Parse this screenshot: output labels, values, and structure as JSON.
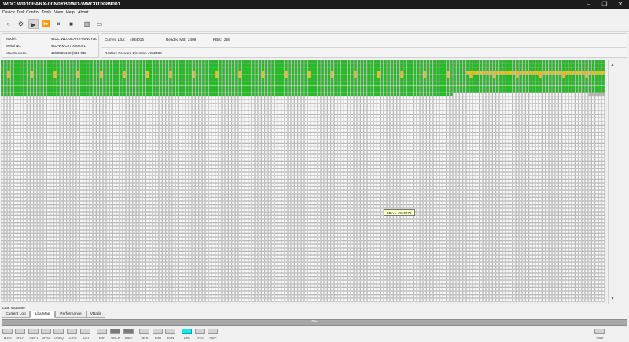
{
  "window": {
    "title": "WDC WD10EARX-00N0YB0WD-WMC0T0089001",
    "controls": [
      "minimize-icon",
      "maximize-icon",
      "close-icon"
    ]
  },
  "menu": [
    "Device",
    "Task Control",
    "Tools",
    "View",
    "Help",
    "About"
  ],
  "toolbar": {
    "buttons": [
      {
        "name": "refresh-icon",
        "glyph": "○"
      },
      {
        "name": "settings-icon",
        "glyph": "⚙"
      },
      {
        "name": "play-icon",
        "glyph": "▶"
      },
      {
        "name": "fast-forward-icon",
        "glyph": "⏩"
      },
      {
        "name": "pause-icon",
        "glyph": "⏸"
      },
      {
        "name": "stop-icon",
        "glyph": "■"
      },
      {
        "name": "panel-icon",
        "glyph": "▥"
      },
      {
        "name": "window-icon",
        "glyph": "▭"
      }
    ]
  },
  "device_info": {
    "model_label": "Model:",
    "model_value": "WDC WD10EARX-00N0YB0",
    "serial_label": "Serial No:",
    "serial_value": "WD-WMC0T0089001",
    "max_sectors_label": "Max Sectors:",
    "max_sectors_value": "1953525168 (931 GB)"
  },
  "progress_info": {
    "current_lba_label": "Current LBA:",
    "current_lba_value": "4934016",
    "readed_mb_label": "Readed MB:",
    "readed_mb_value": "2409",
    "kbs_label": "KB/s:",
    "kbs_value": "256",
    "status_text": "Restore Forward Direction 4932480"
  },
  "sector_map": {
    "cell_states": [
      "ok",
      "slow",
      "pending"
    ],
    "colors": {
      "ok": "#1fbf1f",
      "slow": "#e3c51a",
      "pending": "#f6f6f6",
      "reading": "#b9b9b9"
    },
    "processed_rows": 9,
    "partial_row_cells": 137,
    "slow_row_indices": [
      3,
      4
    ]
  },
  "tooltip": "LBA = 4940275",
  "status_line": "LBa: 4933880",
  "tabs": [
    "Current Log",
    "Lba Map",
    "Performance",
    "VBade"
  ],
  "active_tab": "Lba Map",
  "progress": {
    "value_percent": 0,
    "label": "0%"
  },
  "indicators": [
    {
      "label": "BUSY",
      "state": "off"
    },
    {
      "label": "DRDY",
      "state": "off"
    },
    {
      "label": "DWF1",
      "state": "off"
    },
    {
      "label": "DRSC",
      "state": "off"
    },
    {
      "label": "DREQ",
      "state": "off"
    },
    {
      "label": "CORR",
      "state": "off"
    },
    {
      "label": "IDX1",
      "state": "off"
    },
    {
      "label": "ERR",
      "state": "off"
    },
    {
      "label": "UNCR",
      "state": "dark"
    },
    {
      "label": "ABRT",
      "state": "dark"
    },
    {
      "label": "INFR",
      "state": "off"
    },
    {
      "label": "ERR",
      "state": "off"
    },
    {
      "label": "RUN",
      "state": "off"
    },
    {
      "label": "DRC",
      "state": "lit"
    },
    {
      "label": "TRST",
      "state": "off"
    },
    {
      "label": "RWP",
      "state": "off"
    },
    {
      "label": "PWR",
      "state": "off"
    }
  ]
}
